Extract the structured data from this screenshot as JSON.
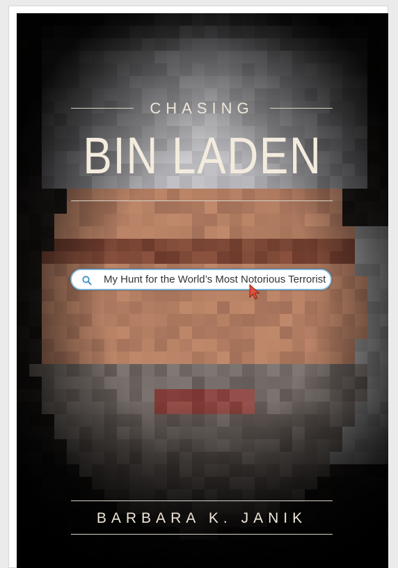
{
  "book": {
    "kicker": "CHASING",
    "title": "BIN LADEN",
    "search_text": "My Hunt for the World’s Most Notorious Terrorist",
    "author": "BARBARA K. JANIK"
  },
  "icons": {
    "search": "search-icon",
    "cursor": "cursor-arrow-icon"
  },
  "colors": {
    "title_text": "#f3ebdd",
    "search_border": "#7fb2d4",
    "cursor": "#e0503a",
    "background": "#0b0b0b"
  }
}
